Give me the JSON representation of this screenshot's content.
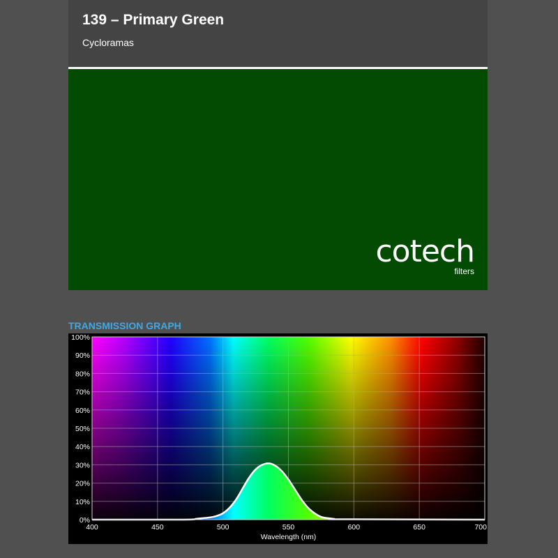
{
  "product": {
    "title": "139 – Primary Green",
    "category": "Cycloramas",
    "swatch_color": "#034a02"
  },
  "logo": {
    "brand": "cotech",
    "sub": "filters"
  },
  "section": {
    "title": "TRANSMISSION GRAPH"
  },
  "colors": {
    "page_background": "#505050",
    "header_background": "#444444",
    "section_title": "#3fa9e6",
    "curve": "#ffffff"
  },
  "chart_data": {
    "type": "area",
    "xlabel": "Wavelength (nm)",
    "ylabel": "",
    "xlim": [
      400,
      700
    ],
    "ylim": [
      0,
      100
    ],
    "x_ticks": [
      400,
      450,
      500,
      550,
      600,
      650,
      700
    ],
    "y_ticks": [
      "0%",
      "10%",
      "20%",
      "30%",
      "40%",
      "50%",
      "60%",
      "70%",
      "80%",
      "90%",
      "100%"
    ],
    "grid": true,
    "series": [
      {
        "x": [
          400,
          470,
          480,
          490,
          495,
          500,
          505,
          510,
          515,
          520,
          525,
          530,
          535,
          540,
          545,
          550,
          555,
          560,
          565,
          570,
          575,
          580,
          585,
          590,
          700
        ],
        "values": [
          0,
          0,
          0.5,
          1.2,
          2,
          3.5,
          6.5,
          11,
          17,
          23,
          27.5,
          30,
          30.8,
          29.5,
          26.5,
          22,
          16.5,
          11,
          6.5,
          3.5,
          1.5,
          0.8,
          0.4,
          0.2,
          0
        ]
      }
    ]
  }
}
